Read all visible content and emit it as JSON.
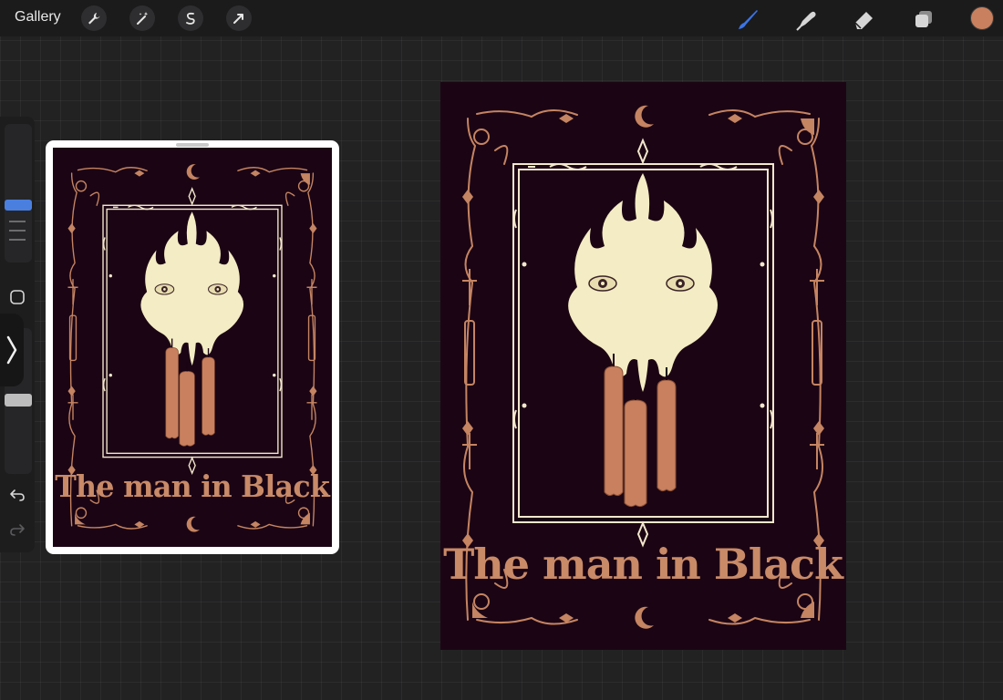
{
  "topbar": {
    "gallery_label": "Gallery",
    "left_tools": [
      "wrench-icon",
      "magic-wand-icon",
      "selection-icon",
      "move-arrow-icon"
    ],
    "right_tools": [
      "brush-icon",
      "smudge-icon",
      "eraser-icon",
      "layers-icon"
    ],
    "active_tool": "brush-icon",
    "active_color": "#c8805e"
  },
  "sidebar": {
    "brush_size_slider": "size-slider",
    "opacity_slider": "opacity-slider",
    "buttons": [
      "modify-square-icon",
      "undo-icon",
      "redo-icon"
    ],
    "accent_color": "#4a7fe0"
  },
  "artwork": {
    "title": "The man in Black",
    "background_color": "#1b0514",
    "frame_color": "#f3e7cd",
    "ornament_color": "#c58462",
    "face_color": "#f4ecc4",
    "candle_color": "#c8805e"
  },
  "reference": {
    "label": "reference-window"
  }
}
